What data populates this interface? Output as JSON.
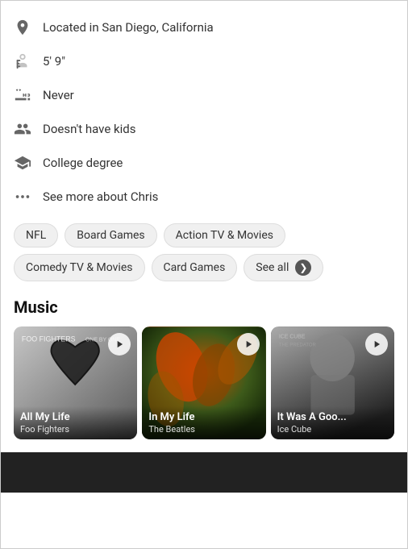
{
  "profile": {
    "location": "Located in San Diego, California",
    "height": "5' 9\"",
    "smoking": "Never",
    "kids": "Doesn't have kids",
    "education": "College degree",
    "see_more": "See more about Chris"
  },
  "interests": {
    "tags": [
      "NFL",
      "Board Games",
      "Action TV & Movies",
      "Comedy TV & Movies",
      "Card Games"
    ],
    "see_all_label": "See all"
  },
  "music": {
    "section_title": "Music",
    "tracks": [
      {
        "title": "All My Life",
        "artist": "Foo Fighters"
      },
      {
        "title": "In My Life",
        "artist": "The Beatles"
      },
      {
        "title": "It Was A Goo...",
        "artist": "Ice Cube"
      }
    ]
  }
}
